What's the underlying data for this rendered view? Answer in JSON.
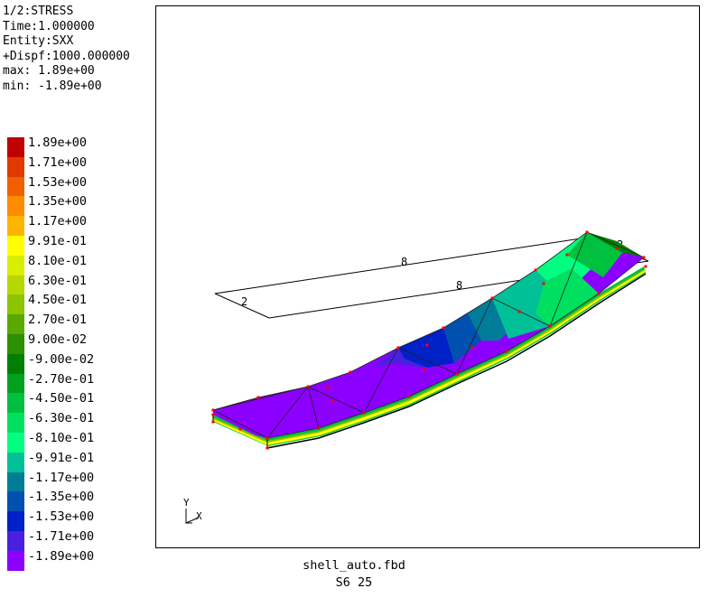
{
  "info": {
    "line1": "1/2:STRESS",
    "line2": "Time:1.000000",
    "line3": "Entity:SXX",
    "line4": "+Dispf:1000.000000",
    "line5": "max: 1.89e+00",
    "line6": "min: -1.89e+00"
  },
  "legend": [
    {
      "label": "1.89e+00",
      "color": "#c00000"
    },
    {
      "label": "1.71e+00",
      "color": "#e03a00"
    },
    {
      "label": "1.53e+00",
      "color": "#f06000"
    },
    {
      "label": "1.35e+00",
      "color": "#ff8c00"
    },
    {
      "label": "1.17e+00",
      "color": "#ffb400"
    },
    {
      "label": "9.91e-01",
      "color": "#ffff00"
    },
    {
      "label": "8.10e-01",
      "color": "#d8ee00"
    },
    {
      "label": "6.30e-01",
      "color": "#b4d800"
    },
    {
      "label": "4.50e-01",
      "color": "#8cc400"
    },
    {
      "label": "2.70e-01",
      "color": "#5aa800"
    },
    {
      "label": "9.00e-02",
      "color": "#2c9000"
    },
    {
      "label": "-9.00e-02",
      "color": "#008000"
    },
    {
      "label": "-2.70e-01",
      "color": "#00a020"
    },
    {
      "label": "-4.50e-01",
      "color": "#00c040"
    },
    {
      "label": "-6.30e-01",
      "color": "#00e060"
    },
    {
      "label": "-8.10e-01",
      "color": "#00ff80"
    },
    {
      "label": "-9.91e-01",
      "color": "#00c098"
    },
    {
      "label": "-1.17e+00",
      "color": "#007c98"
    },
    {
      "label": "-1.35e+00",
      "color": "#0050b0"
    },
    {
      "label": "-1.53e+00",
      "color": "#0020c8"
    },
    {
      "label": "-1.71e+00",
      "color": "#4a20e0"
    },
    {
      "label": "-1.89e+00",
      "color": "#8c00ff"
    }
  ],
  "viewport": {
    "edge_labels": [
      "8",
      "8",
      "2",
      "2"
    ],
    "axis_y": "Y",
    "axis_x": "X"
  },
  "footer": {
    "filename": "shell_auto.fbd",
    "status": "S6 25"
  }
}
